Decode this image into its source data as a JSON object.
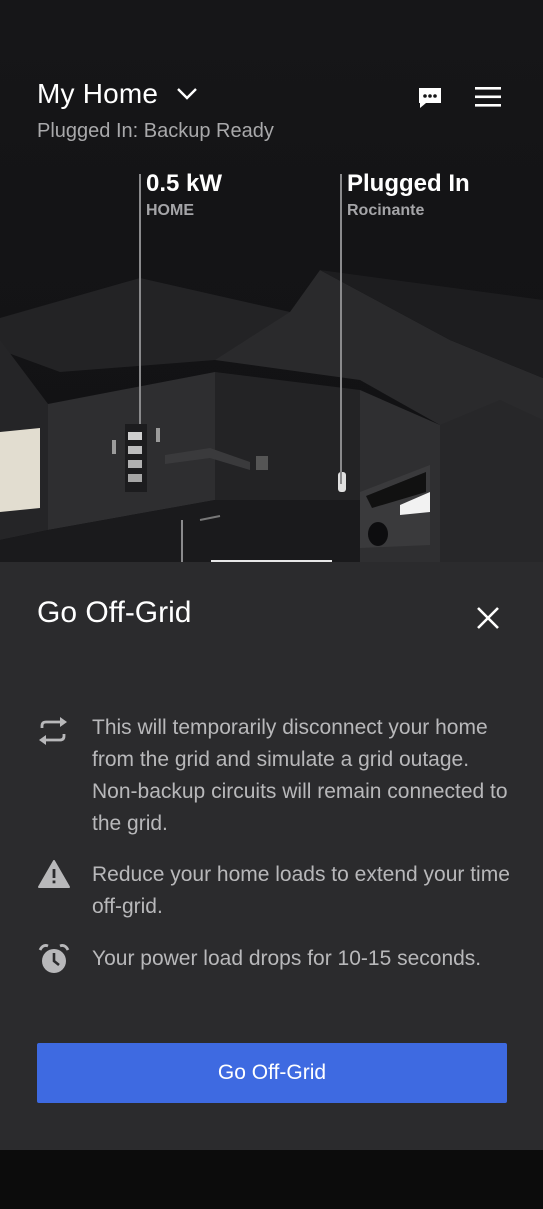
{
  "header": {
    "title": "My Home",
    "subtitle": "Plugged In: Backup Ready",
    "icons": [
      "chevron-down-icon",
      "chat-icon",
      "menu-icon"
    ]
  },
  "callouts": {
    "home": {
      "value": "0.5 kW",
      "label": "HOME"
    },
    "vehicle": {
      "value": "Plugged In",
      "label": "Rocinante"
    }
  },
  "sheet": {
    "title": "Go Off-Grid",
    "items": [
      {
        "icon": "sync-arrows-icon",
        "text": "This will temporarily disconnect your home from the grid and simulate a grid outage. Non-backup circuits will remain connected to the grid."
      },
      {
        "icon": "warning-icon",
        "text": "Reduce your home loads to extend your time off-grid."
      },
      {
        "icon": "alarm-clock-icon",
        "text": "Your power load drops for 10-15 seconds."
      }
    ],
    "button_label": "Go Off-Grid"
  },
  "colors": {
    "accent": "#3e6ae1",
    "sheet_bg": "#2b2b2d",
    "hero_bg": "#141416"
  }
}
